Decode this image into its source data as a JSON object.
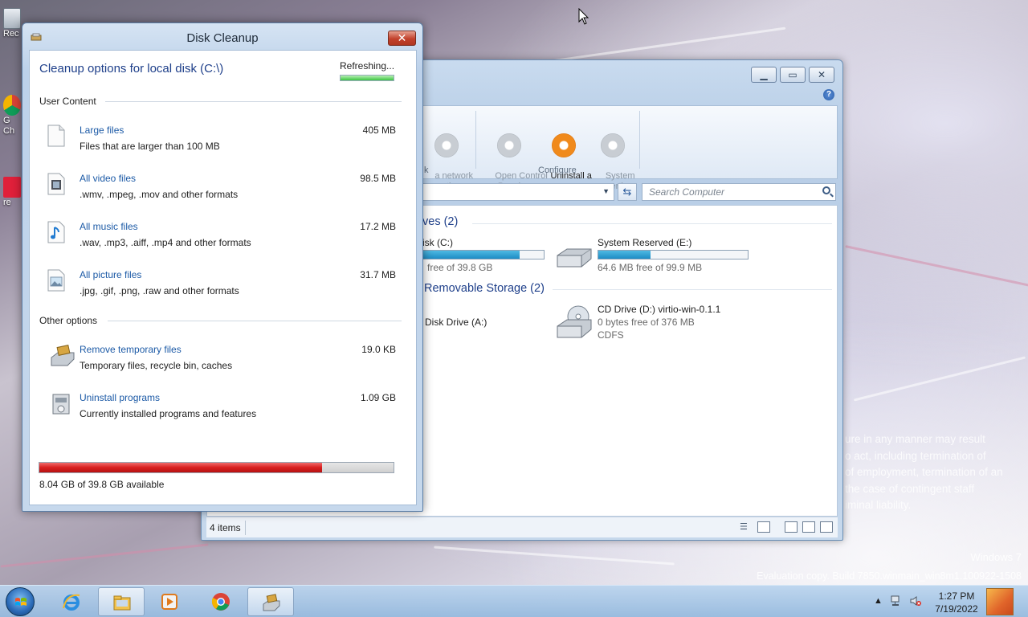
{
  "desktop": {
    "icons": [
      {
        "label": "Rec",
        "name": "recycle-bin"
      },
      {
        "label": "G\nCh",
        "name": "google-chrome-shortcut"
      },
      {
        "label": "re",
        "name": "app-shortcut"
      }
    ],
    "legal_lines": [
      "ure in any manner may result",
      "o act, including termination of",
      "of employment, termination of an",
      "the case of contingent staff",
      "iminal liability."
    ],
    "watermark_title": "Windows 7",
    "watermark_build": "Evaluation copy. Build 7850.winmain_win8m1.100922-1508"
  },
  "explorer": {
    "ribbon": {
      "items": [
        {
          "label": "a network\nocation",
          "icon": "network-location-icon",
          "active": false
        },
        {
          "label": "Open Control\nPanel",
          "icon": "control-panel-icon",
          "active": false
        },
        {
          "label": "Uninstall a\nprogram",
          "icon": "uninstall-program-icon",
          "active": true
        },
        {
          "label": "System\nproperties",
          "icon": "system-properties-icon",
          "active": false
        }
      ],
      "group_left": "k",
      "group_configure": "Configure"
    },
    "search_placeholder": "Search Computer",
    "groups": {
      "drives_title": "ves (2)",
      "removable_title": "Removable Storage (2)"
    },
    "drives": [
      {
        "name": "isk (C:)",
        "sub": "free of 39.8 GB",
        "fill": 0.8
      },
      {
        "name": "System Reserved (E:)",
        "sub": "64.6 MB free of 99.9 MB",
        "fill": 0.35
      }
    ],
    "removable": [
      {
        "name": "Disk Drive (A:)"
      },
      {
        "name": "CD Drive (D:) virtio-win-0.1.1",
        "sub1": "0 bytes free of 376 MB",
        "sub2": "CDFS"
      }
    ],
    "status_count": "4 items"
  },
  "cleanup": {
    "title": "Disk Cleanup",
    "heading": "Cleanup options for local disk (C:\\)",
    "refreshing": "Refreshing...",
    "sections": {
      "user_content": "User Content",
      "other_options": "Other options"
    },
    "user_items": [
      {
        "link": "Large files",
        "desc": "Files that are larger than 100 MB",
        "size": "405 MB",
        "icon": "blank-file-icon"
      },
      {
        "link": "All video files",
        "desc": ".wmv, .mpeg, .mov and other formats",
        "size": "98.5 MB",
        "icon": "video-file-icon"
      },
      {
        "link": "All music files",
        "desc": ".wav, .mp3, .aiff, .mp4 and other formats",
        "size": "17.2 MB",
        "icon": "music-file-icon"
      },
      {
        "link": "All picture files",
        "desc": ".jpg, .gif, .png, .raw and other formats",
        "size": "31.7 MB",
        "icon": "picture-file-icon"
      }
    ],
    "other_items": [
      {
        "link": "Remove temporary files",
        "desc": "Temporary files, recycle bin, caches",
        "size": "19.0 KB",
        "icon": "disk-cleanup-icon"
      },
      {
        "link": "Uninstall programs",
        "desc": "Currently installed programs and features",
        "size": "1.09 GB",
        "icon": "programs-icon"
      }
    ],
    "used_fraction": 0.798,
    "available_text": "8.04 GB of 39.8 GB available"
  },
  "taskbar": {
    "pinned": [
      {
        "name": "internet-explorer-icon"
      },
      {
        "name": "windows-explorer-icon"
      },
      {
        "name": "media-player-icon"
      },
      {
        "name": "chrome-icon"
      },
      {
        "name": "disk-cleanup-taskbar-icon"
      }
    ],
    "clock_time": "1:27 PM",
    "clock_date": "7/19/2022"
  },
  "colors": {
    "link": "#1c5aa6",
    "heading": "#1e3f8a",
    "usage_fill": "#d81e1e",
    "drive_fill": "#1d8cc4",
    "accent_orange": "#f08a1c"
  }
}
